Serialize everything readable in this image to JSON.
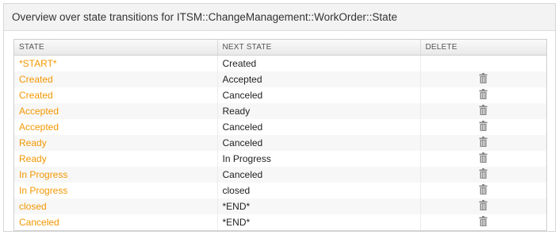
{
  "header": {
    "title": "Overview over state transitions for ITSM::ChangeManagement::WorkOrder::State"
  },
  "table": {
    "columns": [
      "STATE",
      "NEXT STATE",
      "DELETE"
    ],
    "rows": [
      {
        "state": "*START*",
        "next_state": "Created",
        "deletable": false
      },
      {
        "state": "Created",
        "next_state": "Accepted",
        "deletable": true
      },
      {
        "state": "Created",
        "next_state": "Canceled",
        "deletable": true
      },
      {
        "state": "Accepted",
        "next_state": "Ready",
        "deletable": true
      },
      {
        "state": "Accepted",
        "next_state": "Canceled",
        "deletable": true
      },
      {
        "state": "Ready",
        "next_state": "Canceled",
        "deletable": true
      },
      {
        "state": "Ready",
        "next_state": "In Progress",
        "deletable": true
      },
      {
        "state": "In Progress",
        "next_state": "Canceled",
        "deletable": true
      },
      {
        "state": "In Progress",
        "next_state": "closed",
        "deletable": true
      },
      {
        "state": "closed",
        "next_state": "*END*",
        "deletable": true
      },
      {
        "state": "Canceled",
        "next_state": "*END*",
        "deletable": true
      }
    ]
  },
  "colors": {
    "link": "#f39700",
    "icon": "#8a8a8a"
  },
  "icons": {
    "delete": "trash-icon"
  }
}
